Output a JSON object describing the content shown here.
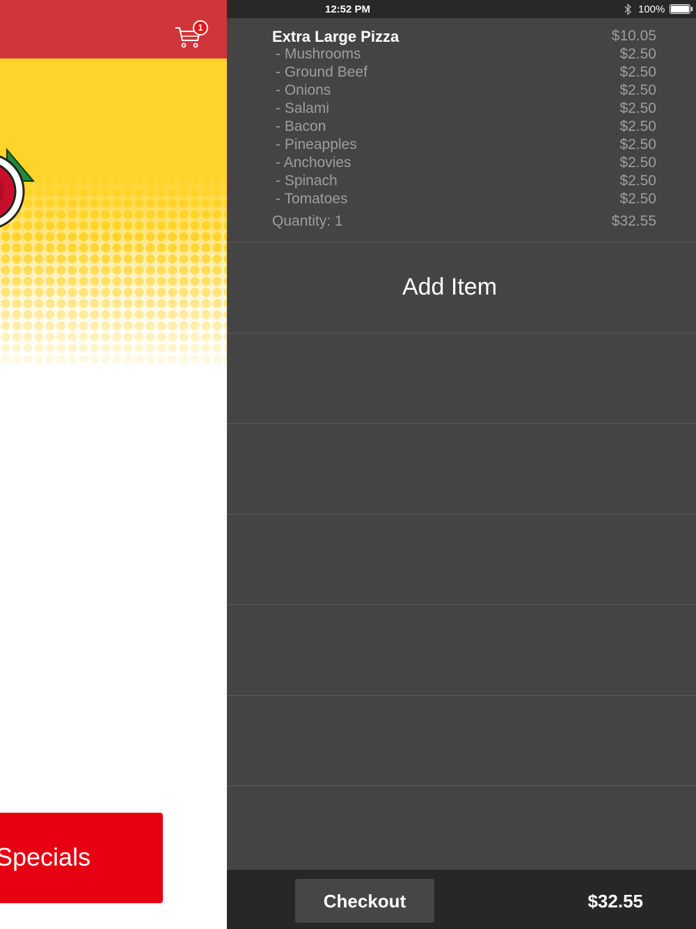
{
  "status_bar": {
    "time": "12:52 PM",
    "battery": "100%",
    "bluetooth_icon": "bluetooth-icon",
    "battery_icon": "battery-full-icon"
  },
  "left_panel": {
    "header_color": "#d0353a",
    "cart_icon": "shopping-cart-icon",
    "cart_badge": "1",
    "specials_label": "Specials",
    "specials_color": "#e60012"
  },
  "cart": {
    "item": {
      "name": "Extra Large Pizza",
      "price": "$10.05",
      "toppings": [
        {
          "label": "- Mushrooms",
          "price": "$2.50"
        },
        {
          "label": "- Ground Beef",
          "price": "$2.50"
        },
        {
          "label": "- Onions",
          "price": "$2.50"
        },
        {
          "label": "- Salami",
          "price": "$2.50"
        },
        {
          "label": "- Bacon",
          "price": "$2.50"
        },
        {
          "label": "- Pineapples",
          "price": "$2.50"
        },
        {
          "label": "- Anchovies",
          "price": "$2.50"
        },
        {
          "label": "- Spinach",
          "price": "$2.50"
        },
        {
          "label": "- Tomatoes",
          "price": "$2.50"
        }
      ],
      "quantity": "Quantity: 1",
      "item_total": "$32.55"
    },
    "add_item_label": "Add Item",
    "checkout_label": "Checkout",
    "total": "$32.55"
  }
}
